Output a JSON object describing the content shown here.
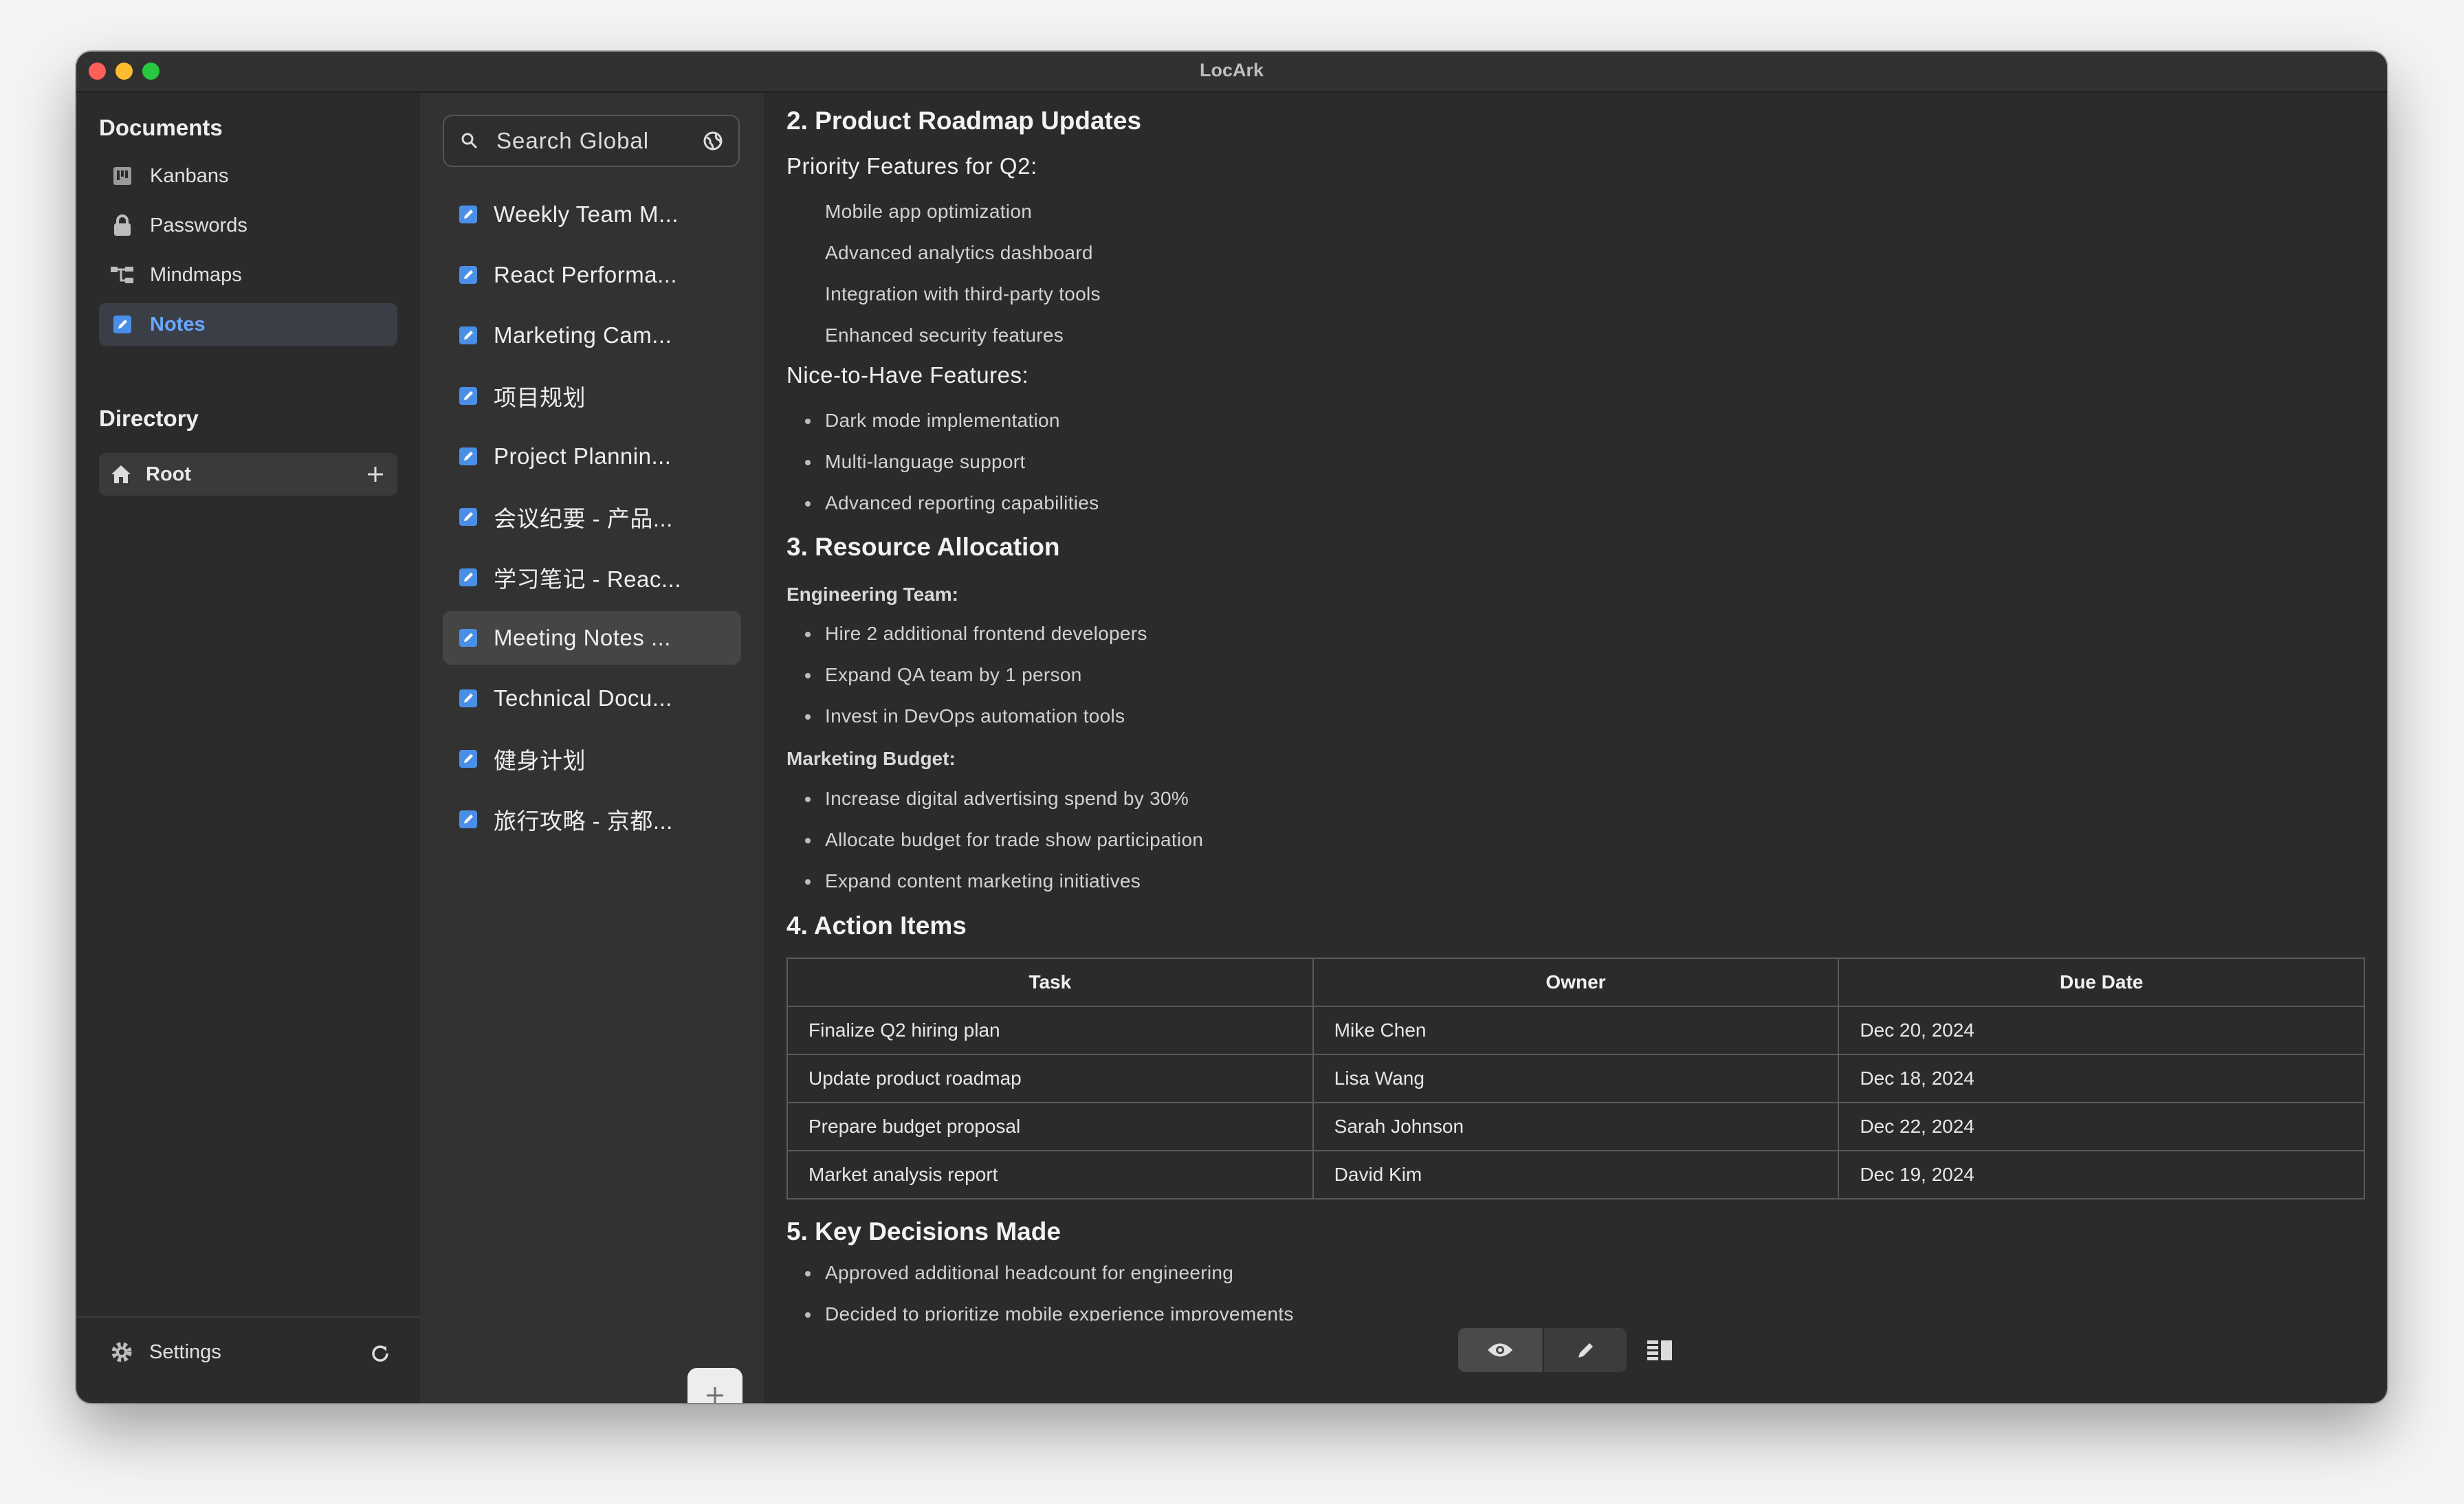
{
  "window": {
    "title": "LocArk"
  },
  "sidebar": {
    "documents_title": "Documents",
    "items": [
      {
        "label": "Kanbans",
        "icon": "kanban-icon"
      },
      {
        "label": "Passwords",
        "icon": "lock-icon"
      },
      {
        "label": "Mindmaps",
        "icon": "mindmap-icon"
      },
      {
        "label": "Notes",
        "icon": "note-icon",
        "active": true
      }
    ],
    "directory_title": "Directory",
    "root_label": "Root",
    "settings_label": "Settings"
  },
  "notes_list": {
    "search_placeholder": "Search Global",
    "items": [
      "Weekly Team M...",
      "React Performa...",
      "Marketing Cam...",
      "项目规划",
      "Project Plannin...",
      "会议纪要 - 产品...",
      "学习笔记 - Reac...",
      "Meeting Notes ...",
      "Technical Docu...",
      "健身计划",
      "旅行攻略 - 京都..."
    ],
    "active_index": 7
  },
  "content": {
    "section2_title": "2. Product Roadmap Updates",
    "priority_title": "Priority Features for Q2:",
    "priority_items": [
      "Mobile app optimization",
      "Advanced analytics dashboard",
      "Integration with third-party tools",
      "Enhanced security features"
    ],
    "nice_title": "Nice-to-Have Features:",
    "nice_items": [
      "Dark mode implementation",
      "Multi-language support",
      "Advanced reporting capabilities"
    ],
    "section3_title": "3. Resource Allocation",
    "eng_title": "Engineering Team:",
    "eng_items": [
      "Hire 2 additional frontend developers",
      "Expand QA team by 1 person",
      "Invest in DevOps automation tools"
    ],
    "mkt_title": "Marketing Budget:",
    "mkt_items": [
      "Increase digital advertising spend by 30%",
      "Allocate budget for trade show participation",
      "Expand content marketing initiatives"
    ],
    "section4_title": "4. Action Items",
    "table": {
      "headers": [
        "Task",
        "Owner",
        "Due Date"
      ],
      "rows": [
        [
          "Finalize Q2 hiring plan",
          "Mike Chen",
          "Dec 20, 2024"
        ],
        [
          "Update product roadmap",
          "Lisa Wang",
          "Dec 18, 2024"
        ],
        [
          "Prepare budget proposal",
          "Sarah Johnson",
          "Dec 22, 2024"
        ],
        [
          "Market analysis report",
          "David Kim",
          "Dec 19, 2024"
        ]
      ]
    },
    "section5_title": "5. Key Decisions Made",
    "decisions": [
      "Approved additional headcount for engineering",
      "Decided to prioritize mobile experience improvements"
    ]
  },
  "colors": {
    "accent": "#6aa7ff",
    "note_icon": "#4a8fe7",
    "background": "#2b2b2b"
  }
}
